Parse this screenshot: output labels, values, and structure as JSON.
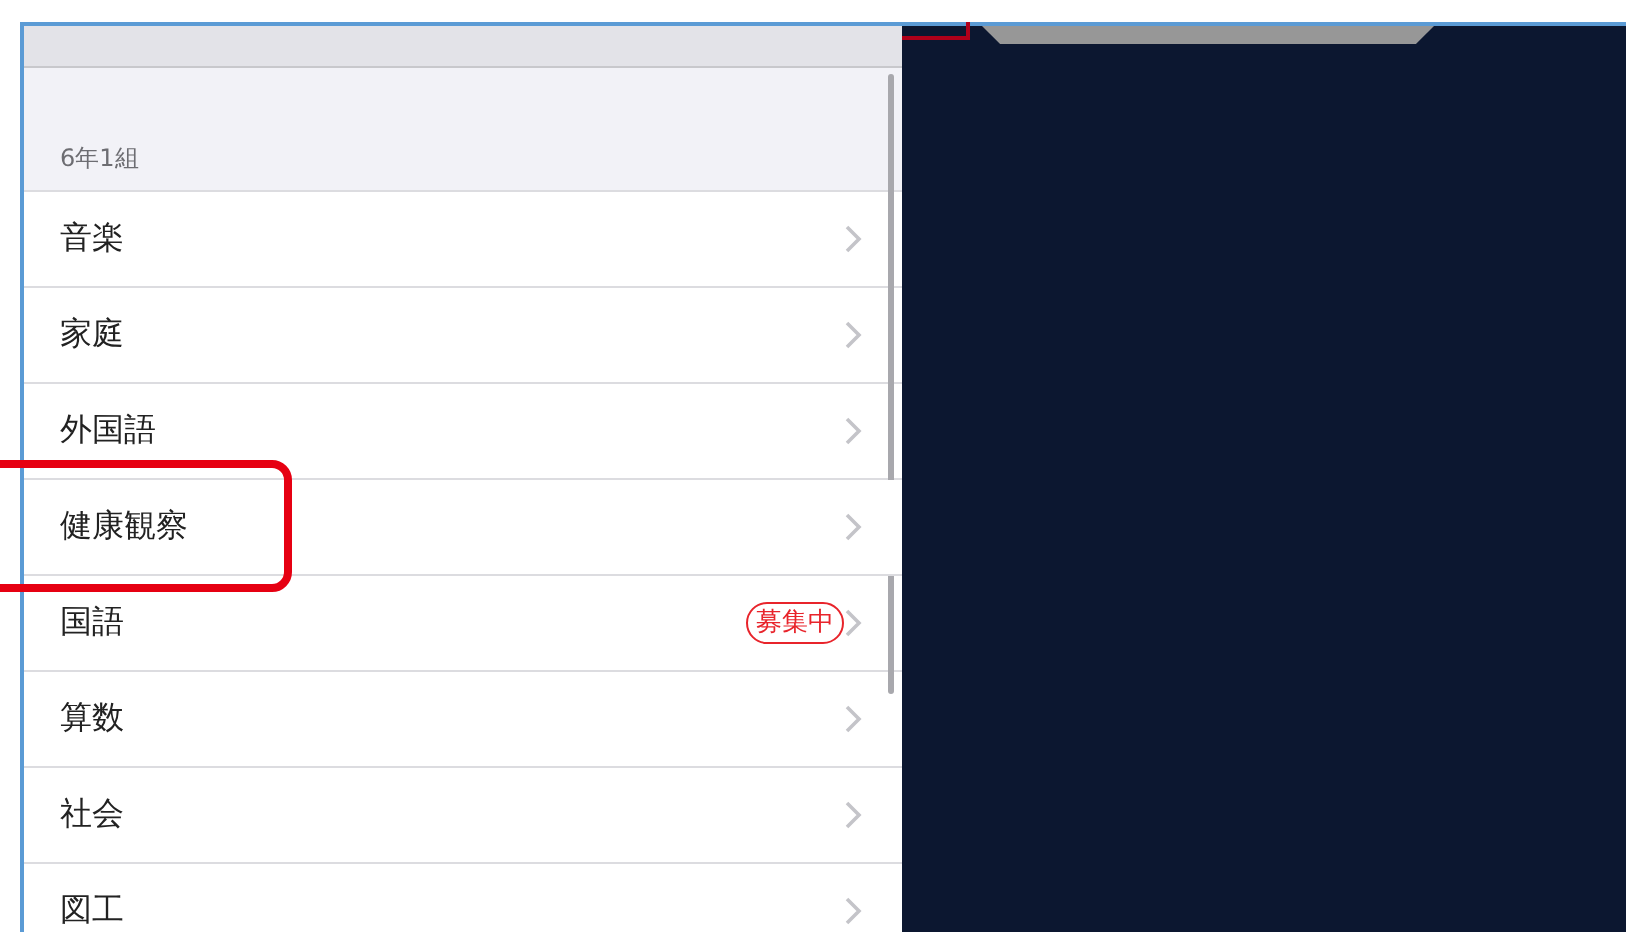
{
  "section_header": "6年1組",
  "items": [
    {
      "label": "音楽",
      "highlighted": false
    },
    {
      "label": "家庭",
      "highlighted": false
    },
    {
      "label": "外国語",
      "highlighted": false
    },
    {
      "label": "健康観察",
      "highlighted": true
    },
    {
      "label": "国語",
      "badge": "募集中",
      "highlighted": false
    },
    {
      "label": "算数",
      "highlighted": false
    },
    {
      "label": "社会",
      "highlighted": false
    },
    {
      "label": "図工",
      "highlighted": false
    }
  ]
}
